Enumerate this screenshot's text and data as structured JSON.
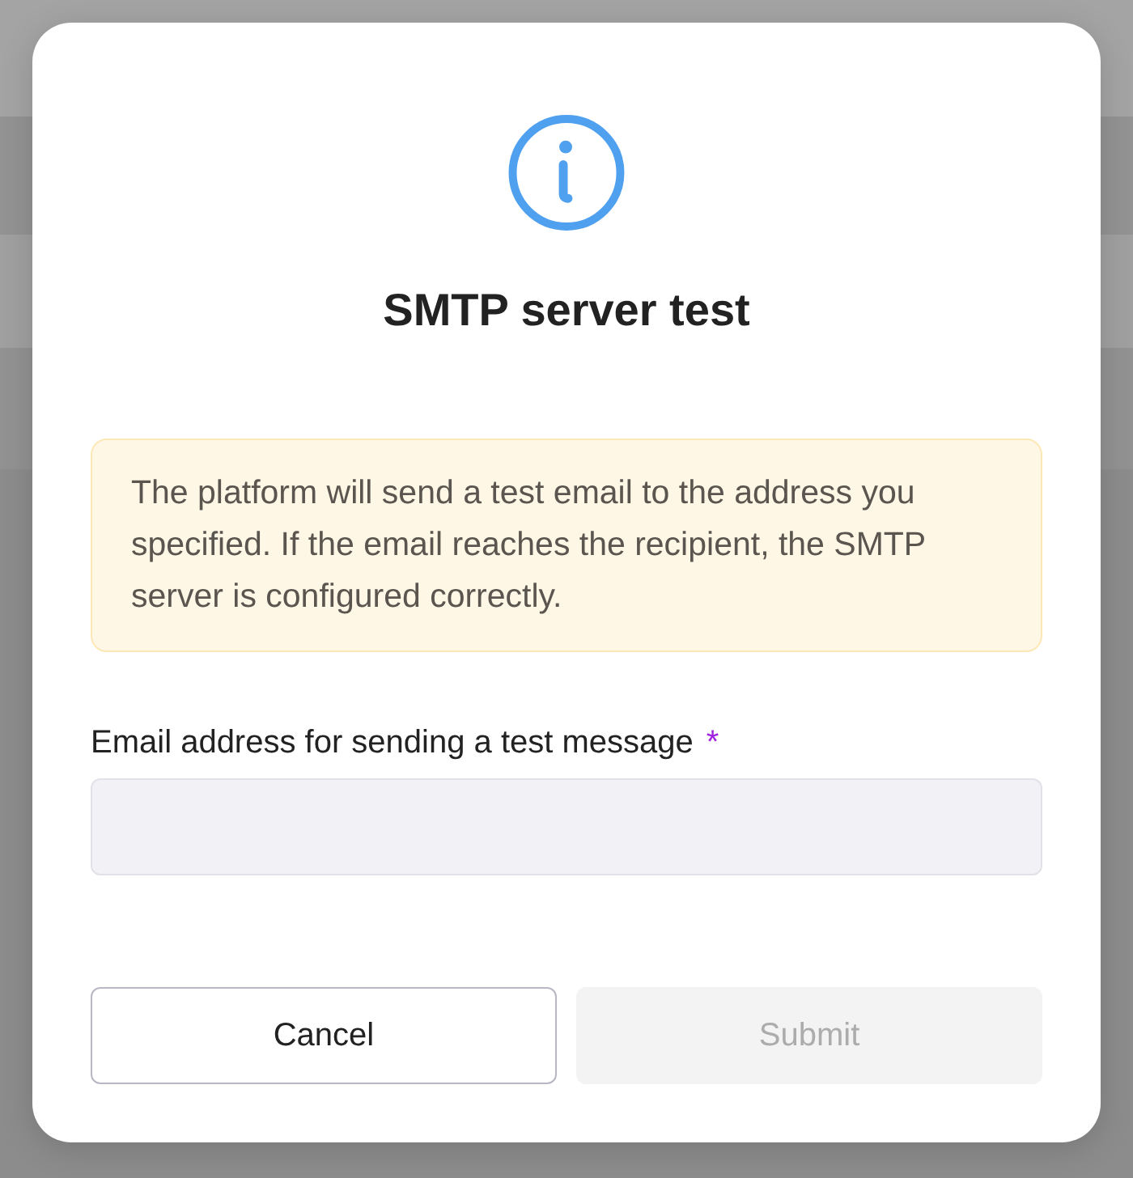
{
  "dialog": {
    "title": "SMTP server test",
    "notice": "The platform will send a test email to the address you specified. If the email reaches the recipient, the SMTP server is configured correctly.",
    "field": {
      "label": "Email address for sending a test message",
      "required": true,
      "required_mark": "*"
    },
    "buttons": [
      {
        "label": "Cancel",
        "kind": "secondary",
        "disabled": false
      },
      {
        "label": "Submit",
        "kind": "primary",
        "disabled": true
      }
    ]
  }
}
